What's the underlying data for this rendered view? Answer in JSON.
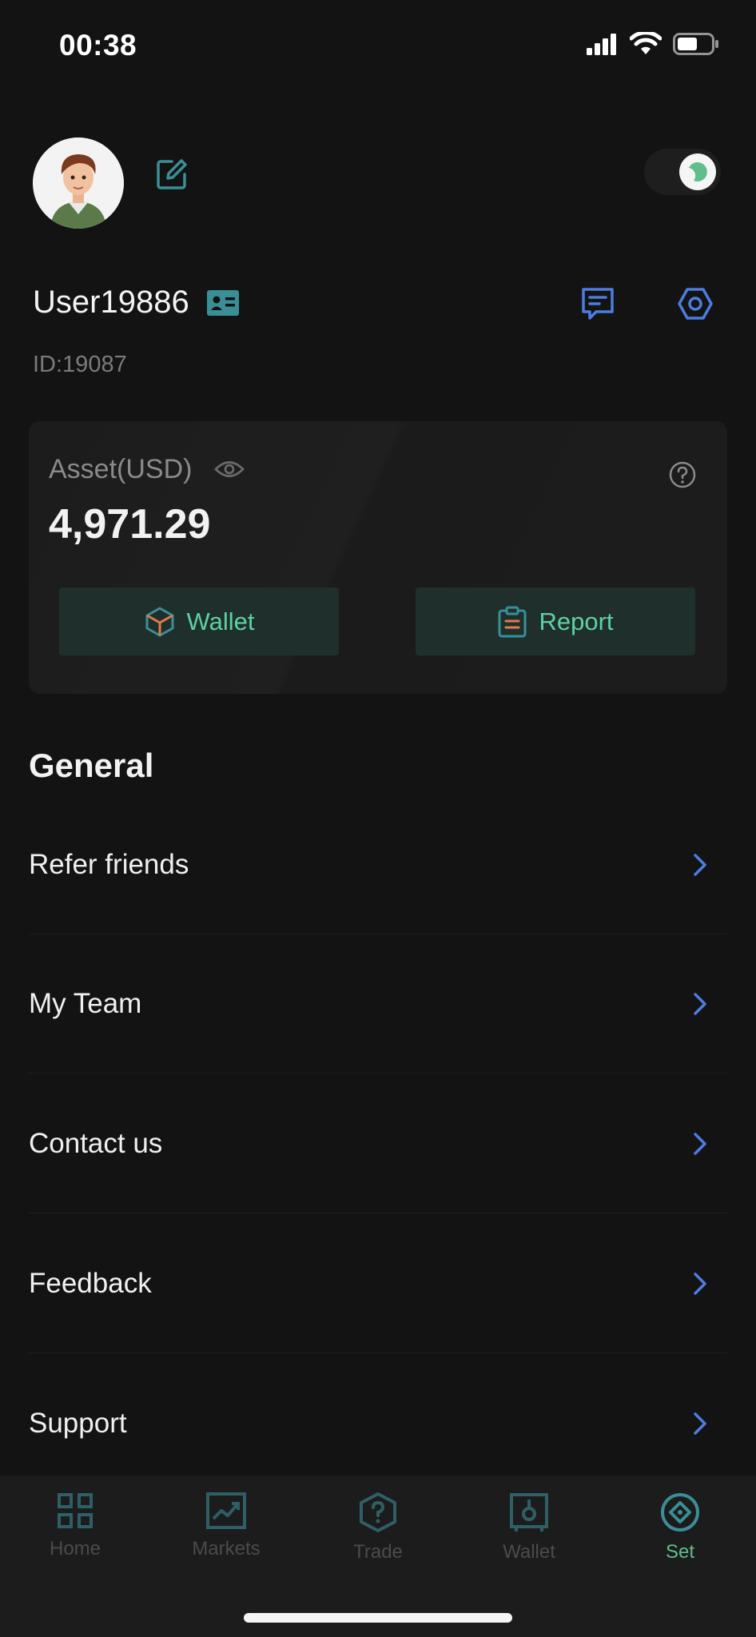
{
  "status_bar": {
    "time": "00:38"
  },
  "profile": {
    "username": "User19886",
    "user_id": "ID:19087"
  },
  "asset_card": {
    "label": "Asset(USD)",
    "value": "4,971.29",
    "wallet_button": "Wallet",
    "report_button": "Report"
  },
  "general": {
    "title": "General",
    "items": [
      {
        "label": "Refer friends"
      },
      {
        "label": "My Team"
      },
      {
        "label": "Contact us"
      },
      {
        "label": "Feedback"
      },
      {
        "label": "Support"
      }
    ]
  },
  "tabbar": {
    "tabs": [
      {
        "label": "Home",
        "icon": "grid-icon"
      },
      {
        "label": "Markets",
        "icon": "chart-icon"
      },
      {
        "label": "Trade",
        "icon": "question-hex-icon"
      },
      {
        "label": "Wallet",
        "icon": "safe-icon"
      },
      {
        "label": "Set",
        "icon": "diamond-circle-icon"
      }
    ],
    "active": "Set"
  },
  "colors": {
    "accent_teal": "#3a8f96",
    "accent_blue": "#4c7de0",
    "accent_green": "#5fd0a4",
    "background": "#131313"
  }
}
